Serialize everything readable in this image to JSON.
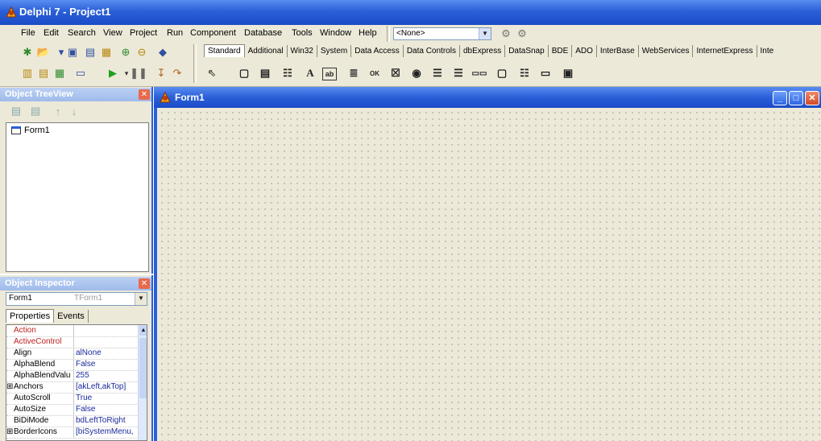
{
  "app": {
    "title": "Delphi 7 - Project1"
  },
  "menu": [
    "File",
    "Edit",
    "Search",
    "View",
    "Project",
    "Run",
    "Component",
    "Database",
    "Tools",
    "Window",
    "Help"
  ],
  "toolbar": {
    "desktop_combo": "<None>"
  },
  "palette": {
    "tabs": [
      "Standard",
      "Additional",
      "Win32",
      "System",
      "Data Access",
      "Data Controls",
      "dbExpress",
      "DataSnap",
      "BDE",
      "ADO",
      "InterBase",
      "WebServices",
      "InternetExpress",
      "Inte"
    ],
    "components": [
      "pointer",
      "frames",
      "main-menu",
      "popup-menu",
      "label",
      "edit",
      "memo",
      "button",
      "checkbox",
      "radio-button",
      "listbox",
      "combobox",
      "scrollbar",
      "groupbox",
      "radiogroup",
      "panel",
      "action-list"
    ]
  },
  "object_treeview": {
    "title": "Object TreeView",
    "items": [
      "Form1"
    ]
  },
  "object_inspector": {
    "title": "Object Inspector",
    "object_name": "Form1",
    "object_type": "TForm1",
    "tabs": [
      "Properties",
      "Events"
    ],
    "properties": [
      {
        "name": "Action",
        "value": "",
        "red": true
      },
      {
        "name": "ActiveControl",
        "value": "",
        "red": true
      },
      {
        "name": "Align",
        "value": "alNone"
      },
      {
        "name": "AlphaBlend",
        "value": "False"
      },
      {
        "name": "AlphaBlendValu",
        "value": "255"
      },
      {
        "name": "Anchors",
        "value": "[akLeft,akTop]",
        "plus": true
      },
      {
        "name": "AutoScroll",
        "value": "True"
      },
      {
        "name": "AutoSize",
        "value": "False"
      },
      {
        "name": "BiDiMode",
        "value": "bdLeftToRight"
      },
      {
        "name": "BorderIcons",
        "value": "[biSystemMenu,",
        "plus": true
      }
    ]
  },
  "form": {
    "title": "Form1"
  },
  "colors": {
    "xp_blue": "#2a5fd8",
    "face": "#ece9d8",
    "value_blue": "#1a2a9a",
    "reference_red": "#c02020"
  }
}
